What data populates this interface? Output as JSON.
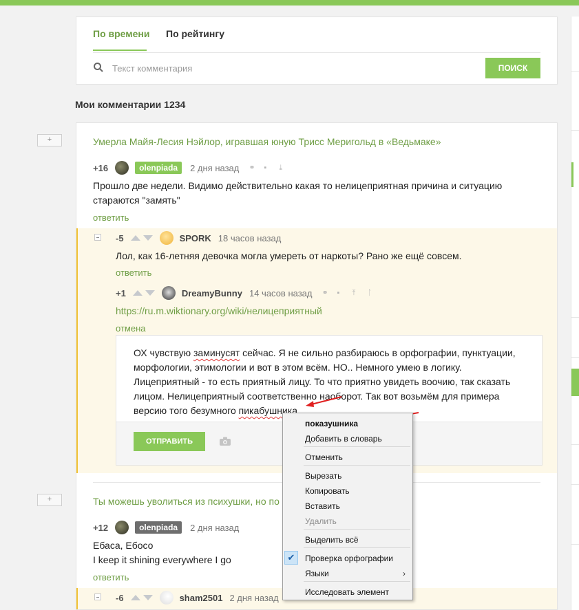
{
  "tabs": {
    "by_time": "По времени",
    "by_rating": "По рейтингу"
  },
  "search": {
    "placeholder": "Текст комментария",
    "button": "ПОИСК"
  },
  "my_comments_label": "Мои комментарии 1234",
  "expand_label": "+",
  "post1": {
    "title": "Умерла Майя-Лесия Нэйлор, игравшая юную Трисс Меригольд в «Ведьмаке»",
    "comment": {
      "rating": "+16",
      "user": "olenpiada",
      "time": "2 дня назад",
      "text_line1": "Прошло две недели. Видимо действительно какая то нелицеприятная причина и ситуацию",
      "text_line2": "стараются \"замять\"",
      "reply": "ответить"
    },
    "reply1": {
      "rating": "-5",
      "user": "SPORK",
      "time": "18 часов назад",
      "text": "Лол, как 16-летняя девочка могла умереть от наркоты? Рано же ещё совсем.",
      "reply": "ответить"
    },
    "reply2": {
      "rating": "+1",
      "user": "DreamyBunny",
      "time": "14 часов назад",
      "link": "https://ru.m.wiktionary.org/wiki/нелицеприятный",
      "cancel": "отмена"
    },
    "editor": {
      "l1a": "ОХ чувствую ",
      "l1b": "заминусят",
      "l1c": " сейчас. Я не сильно разбираюсь в орфографии, пунктуации,",
      "l2": "морфологии, этимологии и вот в этом всём. НО.. Немного умею в логику.",
      "l3": "Лицеприятный - то есть приятный лицу. То что приятно увидеть воочию, так сказать",
      "l4": "лицом. Нелицеприятный соответственно наоборот. Так вот возьмём для примера",
      "l5a": "версию того безумного ",
      "l5b": "пикабушника",
      "send": "ОТПРАВИТЬ"
    }
  },
  "post2": {
    "title": "Ты можешь уволиться из психушки, но по",
    "comment": {
      "rating": "+12",
      "user": "olenpiada",
      "time": "2 дня назад",
      "line1": "Ебаса, Ебосо",
      "line2": "I keep it shining everywhere I go",
      "reply": "ответить"
    },
    "reply1": {
      "rating": "-6",
      "user": "sham2501",
      "time": "2 дня назад"
    }
  },
  "context_menu": {
    "suggestion": "показушника",
    "add_dict": "Добавить в словарь",
    "undo": "Отменить",
    "cut": "Вырезать",
    "copy": "Копировать",
    "paste": "Вставить",
    "delete": "Удалить",
    "select_all": "Выделить всё",
    "spellcheck": "Проверка орфографии",
    "languages": "Языки",
    "inspect": "Исследовать элемент"
  },
  "colors": {
    "accent": "#8ac858",
    "link": "#6f9e45",
    "nested_bg": "#fdf8e8",
    "nested_border": "#f1c233",
    "badge_gray": "#6e6e6e",
    "annotation": "#e02020"
  }
}
